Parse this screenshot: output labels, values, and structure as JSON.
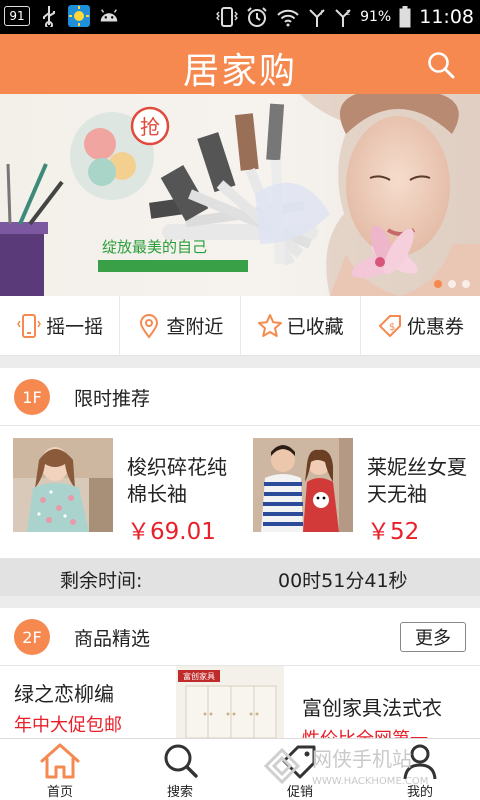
{
  "status_bar": {
    "notification_badge": "91",
    "battery": "91%",
    "time": "11:08"
  },
  "header": {
    "title": "居家购",
    "search_icon": "search-icon"
  },
  "banner": {
    "promo_sticker": "抢",
    "tagline": "绽放最美的自己"
  },
  "quick_nav": [
    {
      "label": "摇一摇",
      "icon": "phone-shake-icon"
    },
    {
      "label": "查附近",
      "icon": "location-pin-icon"
    },
    {
      "label": "已收藏",
      "icon": "star-icon"
    },
    {
      "label": "优惠券",
      "icon": "coupon-icon"
    }
  ],
  "section_limited": {
    "floor": "1F",
    "title": "限时推荐",
    "products": [
      {
        "name": "梭织碎花纯棉长袖",
        "price": "￥69.01"
      },
      {
        "name": "莱妮丝女夏天无袖",
        "price": "￥52"
      }
    ]
  },
  "countdown": {
    "label": "剩余时间:",
    "value": "00时51分41秒"
  },
  "section_featured": {
    "floor": "2F",
    "title": "商品精选",
    "more_label": "更多",
    "items": [
      {
        "title": "绿之恋柳编",
        "subtitle": "年中大促包邮"
      },
      {
        "title": "富创家具法式衣",
        "subtitle": "性价比全网第一"
      }
    ],
    "image_caption": "富创家具"
  },
  "bottom_nav": [
    {
      "label": "首页",
      "icon": "home-icon",
      "active": true
    },
    {
      "label": "搜索",
      "icon": "search-icon"
    },
    {
      "label": "促销",
      "icon": "tag-icon"
    },
    {
      "label": "我的",
      "icon": "user-icon"
    }
  ],
  "watermark": {
    "text": "网侠手机站",
    "url": "WWW.HACKHOME.COM"
  },
  "colors": {
    "accent": "#f5894f",
    "price": "#e8202a"
  }
}
